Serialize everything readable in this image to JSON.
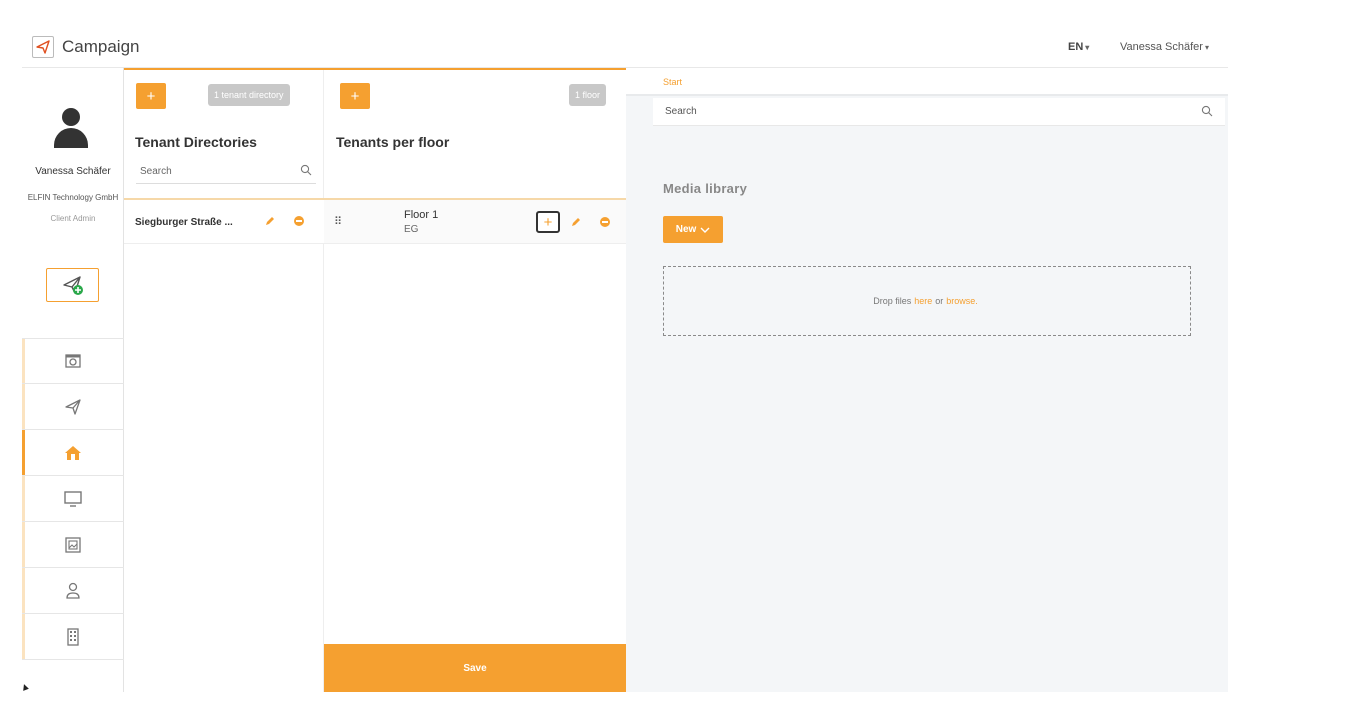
{
  "app": {
    "title": "Campaign",
    "language": "EN",
    "user_menu": "Vanessa Schäfer"
  },
  "profile": {
    "name": "Vanessa Schäfer",
    "company": "ELFIN Technology GmbH",
    "role": "Client Admin"
  },
  "nav": {
    "items": [
      {
        "icon": "camera-screen-icon"
      },
      {
        "icon": "paper-plane-icon"
      },
      {
        "icon": "home-icon",
        "active": true
      },
      {
        "icon": "monitor-icon"
      },
      {
        "icon": "image-frame-icon"
      },
      {
        "icon": "user-icon"
      },
      {
        "icon": "building-icon"
      }
    ]
  },
  "directories": {
    "add_label": "+",
    "count_badge": "1 tenant directory",
    "heading": "Tenant Directories",
    "search_placeholder": "Search",
    "rows": [
      {
        "label": "Siegburger Straße ..."
      }
    ]
  },
  "floors": {
    "add_label": "+",
    "count_badge": "1 floor",
    "heading": "Tenants per floor",
    "rows": [
      {
        "grip": "⠿",
        "name": "Floor 1",
        "sub": "EG",
        "add_label": "+"
      }
    ],
    "save_label": "Save"
  },
  "media": {
    "breadcrumb": "Start",
    "search_placeholder": "Search",
    "title": "Media library",
    "new_label": "New",
    "drop_prefix": "Drop files",
    "drop_here": "here",
    "drop_or": "or",
    "drop_browse": "browse."
  },
  "colors": {
    "accent": "#f5a030",
    "panel_bg": "#f4f6f8",
    "badge_gray": "#c8c8c8"
  }
}
